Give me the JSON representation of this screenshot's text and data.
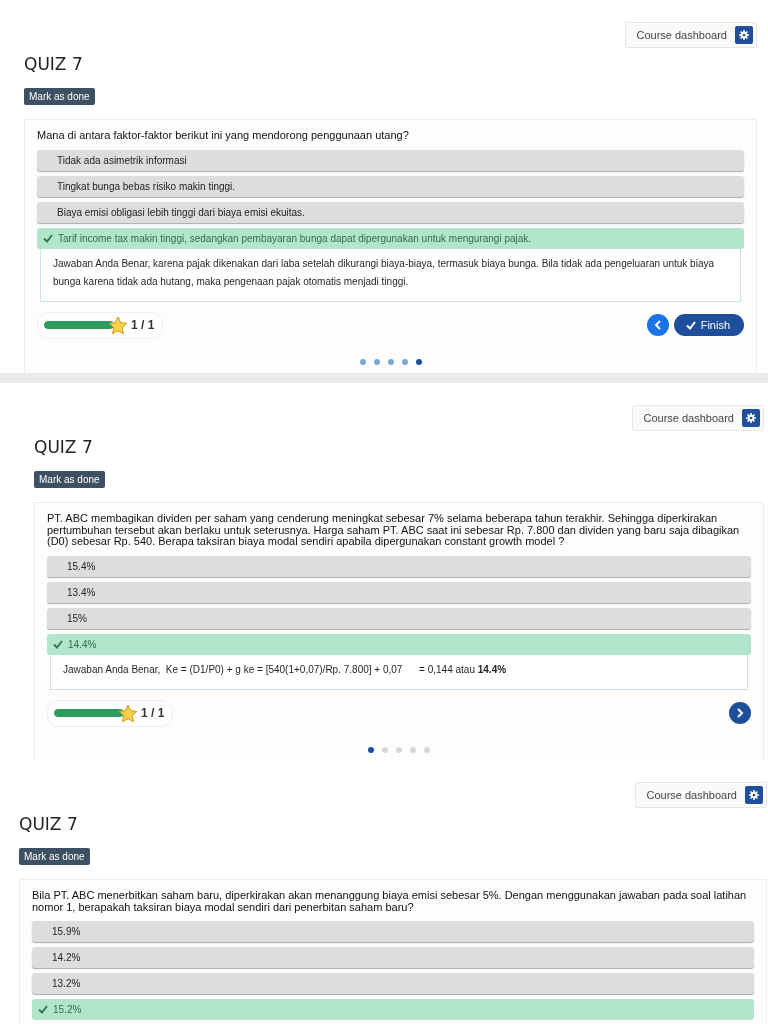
{
  "panels": [
    {
      "dashboard_button": "Course dashboard",
      "title": "QUIZ 7",
      "mark_done_button": "Mark as done",
      "question": "Mana di antara faktor-faktor berikut ini yang mendorong penggunaan utang?",
      "answers": [
        {
          "text": "Tidak ada asimetrik informasi",
          "selected": false
        },
        {
          "text": "Tingkat bunga bebas risiko makin tinggi.",
          "selected": false
        },
        {
          "text": "Biaya emisi obligasi lebih tinggi dari biaya emisi ekuitas.",
          "selected": false
        },
        {
          "text": "Tarif income tax makin tinggi, sedangkan pembayaran bunga dapat dipergunakan untuk mengurangi pajak.",
          "selected": true
        }
      ],
      "feedback": "Jawaban Anda Benar, karena pajak dikenakan dari laba setelah dikurangi biaya-biaya, termasuk biaya bunga. Bila tidak ada pengeluaran untuk biaya bunga karena tidak ada hutang, maka pengenaan pajak otomatis menjadi tinggi.",
      "progress": {
        "level": 1,
        "score": "1 / 1"
      },
      "nav": [
        {
          "kind": "prev"
        },
        {
          "kind": "finish",
          "label": "Finish"
        }
      ],
      "dots": [
        {
          "selected": false
        },
        {
          "selected": false
        },
        {
          "selected": false
        },
        {
          "selected": false
        },
        {
          "selected": true
        }
      ]
    },
    {
      "dashboard_button": "Course dashboard",
      "title": "QUIZ 7",
      "mark_done_button": "Mark as done",
      "question": "PT. ABC membagikan dividen per saham yang cenderung meningkat sebesar 7% selama beberapa tahun terakhir. Sehingga diperkirakan pertumbuhan tersebut akan berlaku untuk seterusnya. Harga saham PT. ABC saat ini sebesar Rp. 7.800 dan dividen yang baru saja dibagikan (D0) sebesar Rp. 540. Berapa taksiran biaya modal sendiri apabila dipergunakan constant growth model ?",
      "answers": [
        {
          "text": "15.4%",
          "selected": false
        },
        {
          "text": "13.4%",
          "selected": false
        },
        {
          "text": "15%",
          "selected": false
        },
        {
          "text": "14.4%",
          "selected": true
        }
      ],
      "feedback": "Jawaban Anda Benar,  Ke = (D1/P0) + g ke = [540(1+0,07)/Rp. 7.800] + 0,07      = 0,144 atau **14.4%**",
      "progress": {
        "level": 1,
        "score": "1 / 1"
      },
      "nav": [
        {
          "kind": "next"
        }
      ],
      "dots": [
        {
          "selected": true
        },
        {
          "selected": false
        },
        {
          "selected": false
        },
        {
          "selected": false
        },
        {
          "selected": false
        }
      ]
    },
    {
      "dashboard_button": "Course dashboard",
      "title": "QUIZ 7",
      "mark_done_button": "Mark as done",
      "question": "Bila PT. ABC menerbitkan saham baru, diperkirakan akan menanggung biaya emisi sebesar 5%. Dengan menggunakan jawaban pada soal latihan nomor 1, berapakah taksiran biaya modal sendiri dari penerbitan saham baru?",
      "answers": [
        {
          "text": "15.9%",
          "selected": false
        },
        {
          "text": "14.2%",
          "selected": false
        },
        {
          "text": "13.2%",
          "selected": false
        },
        {
          "text": "15.2%",
          "selected": true
        }
      ]
    }
  ]
}
